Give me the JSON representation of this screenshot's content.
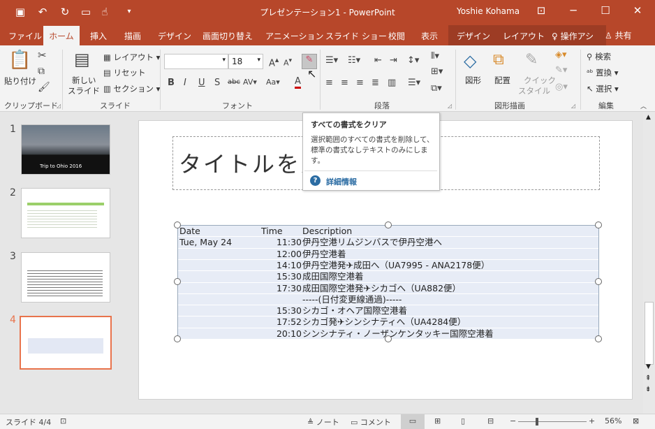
{
  "window": {
    "title": "プレゼンテーション1 - PowerPoint",
    "user": "Yoshie Kohama"
  },
  "ribbon_tabs": [
    "ファイル",
    "ホーム",
    "挿入",
    "描画",
    "デザイン",
    "画面切り替え",
    "アニメーション",
    "スライド ショー",
    "校閲",
    "表示"
  ],
  "context_tabs": [
    "デザイン",
    "レイアウト"
  ],
  "tellme": "操作アシ",
  "share": "共有",
  "clipboard": {
    "paste": "貼り付け",
    "group": "クリップボード"
  },
  "slides_group": {
    "new_slide_1": "新しい",
    "new_slide_2": "スライド",
    "layout": "レイアウト",
    "reset": "リセット",
    "section": "セクション",
    "group": "スライド"
  },
  "font": {
    "size": "18",
    "group": "フォント"
  },
  "paragraph": {
    "group": "段落"
  },
  "drawing": {
    "shapes": "図形",
    "arrange": "配置",
    "quick_1": "クイック",
    "quick_2": "スタイル",
    "group": "図形描画"
  },
  "editing": {
    "find": "検索",
    "replace": "置換",
    "select": "選択",
    "group": "編集"
  },
  "tooltip": {
    "title": "すべての書式をクリア",
    "body": "選択範囲のすべての書式を削除して、標準の書式なしテキストのみにします。",
    "link": "詳細情報"
  },
  "slides": [
    {
      "num": "1",
      "caption": "Trip to Ohio 2016"
    },
    {
      "num": "2"
    },
    {
      "num": "3"
    },
    {
      "num": "4"
    }
  ],
  "title_placeholder": "タイトルを入",
  "table": {
    "headers": [
      "Date",
      "Time",
      "Description"
    ],
    "rows": [
      [
        "Tue, May 24",
        "11:30",
        "伊丹空港リムジンバスで伊丹空港へ"
      ],
      [
        "",
        "12:00",
        "伊丹空港着"
      ],
      [
        "",
        "14:10",
        "伊丹空港発✈成田へ（UA7995 - ANA2178便）"
      ],
      [
        "",
        "15:30",
        "成田国際空港着"
      ],
      [
        "",
        "17:30",
        "成田国際空港発✈シカゴへ（UA882便）"
      ],
      [
        "",
        "",
        "-----(日付変更線通過)-----"
      ],
      [
        "",
        "15:30",
        "シカゴ・オヘア国際空港着"
      ],
      [
        "",
        "17:52",
        "シカゴ発✈シンシナティへ（UA4284便）"
      ],
      [
        "",
        "20:10",
        "シンシナティ・ノーザンケンタッキー国際空港着"
      ]
    ]
  },
  "status": {
    "slide": "スライド 4/4",
    "notes": "ノート",
    "comments": "コメント",
    "zoom": "56%"
  },
  "colors": {
    "accent": "#b7472a",
    "selected_slide": "#e8734c"
  }
}
